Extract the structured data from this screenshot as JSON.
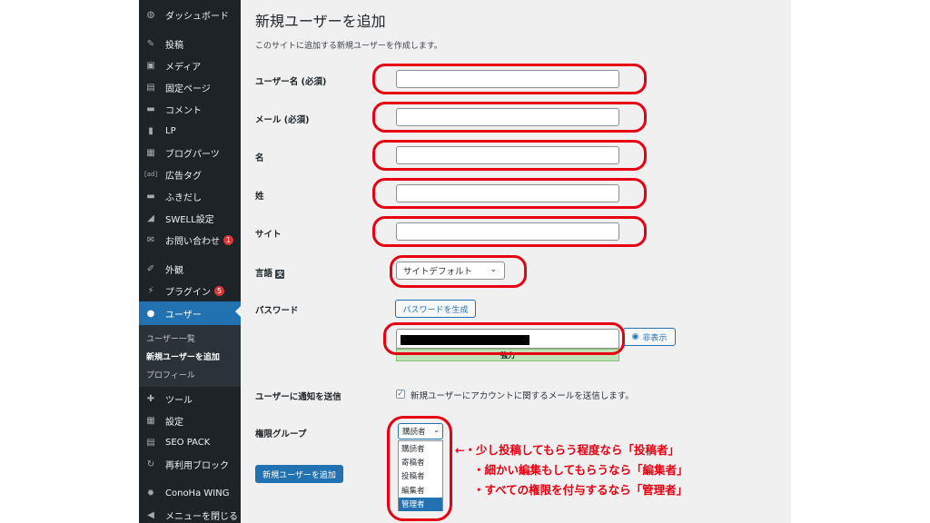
{
  "sidebar": {
    "items": [
      {
        "label": "ダッシュボード",
        "icon": "dashboard-icon"
      },
      {
        "label": "投稿",
        "icon": "pin-icon"
      },
      {
        "label": "メディア",
        "icon": "media-icon"
      },
      {
        "label": "固定ページ",
        "icon": "page-icon"
      },
      {
        "label": "コメント",
        "icon": "comment-icon"
      },
      {
        "label": "LP",
        "icon": "document-icon"
      },
      {
        "label": "ブログパーツ",
        "icon": "grid-icon"
      },
      {
        "label": "広告タグ",
        "icon": "ad-icon"
      },
      {
        "label": "ふきだし",
        "icon": "balloon-icon"
      },
      {
        "label": "SWELL設定",
        "icon": "swell-icon"
      },
      {
        "label": "お問い合わせ",
        "icon": "mail-icon",
        "badge": "1"
      },
      {
        "label": "外観",
        "icon": "brush-icon"
      },
      {
        "label": "プラグイン",
        "icon": "plugin-icon",
        "badge": "5"
      },
      {
        "label": "ユーザー",
        "icon": "user-icon"
      },
      {
        "label": "ツール",
        "icon": "wrench-icon"
      },
      {
        "label": "設定",
        "icon": "settings-icon"
      },
      {
        "label": "SEO PACK",
        "icon": "seo-icon"
      },
      {
        "label": "再利用ブロック",
        "icon": "reuse-icon"
      },
      {
        "label": "ConoHa WING",
        "icon": "gear-icon"
      },
      {
        "label": "メニューを閉じる",
        "icon": "collapse-icon"
      }
    ],
    "submenu": [
      "ユーザー一覧",
      "新規ユーザーを追加",
      "プロフィール"
    ]
  },
  "main": {
    "title": "新規ユーザーを追加",
    "description": "このサイトに追加する新規ユーザーを作成します。",
    "fields": {
      "username": "ユーザー名 (必須)",
      "email": "メール (必須)",
      "first_name": "名",
      "last_name": "姓",
      "website": "サイト",
      "language": "言語",
      "password": "パスワード",
      "notify": "ユーザーに通知を送信",
      "role": "権限グループ"
    },
    "language_value": "サイトデフォルト",
    "generate_password_label": "パスワードを生成",
    "hide_label": "非表示",
    "strength_label": "強力",
    "notify_text": "新規ユーザーにアカウントに関するメールを送信します。",
    "role_selected": "購読者",
    "role_options": [
      "購読者",
      "寄稿者",
      "投稿者",
      "編集者",
      "管理者"
    ],
    "submit_label": "新規ユーザーを追加"
  },
  "annotations": [
    "←・少し投稿してもらう程度なら「投稿者」",
    "・細かい編集もしてもらうなら「編集者」",
    "・すべての権限を付与するなら「管理者」"
  ],
  "colors": {
    "sidebar": "#1d2327",
    "accent": "#2271b1",
    "annotation": "#e60012"
  }
}
